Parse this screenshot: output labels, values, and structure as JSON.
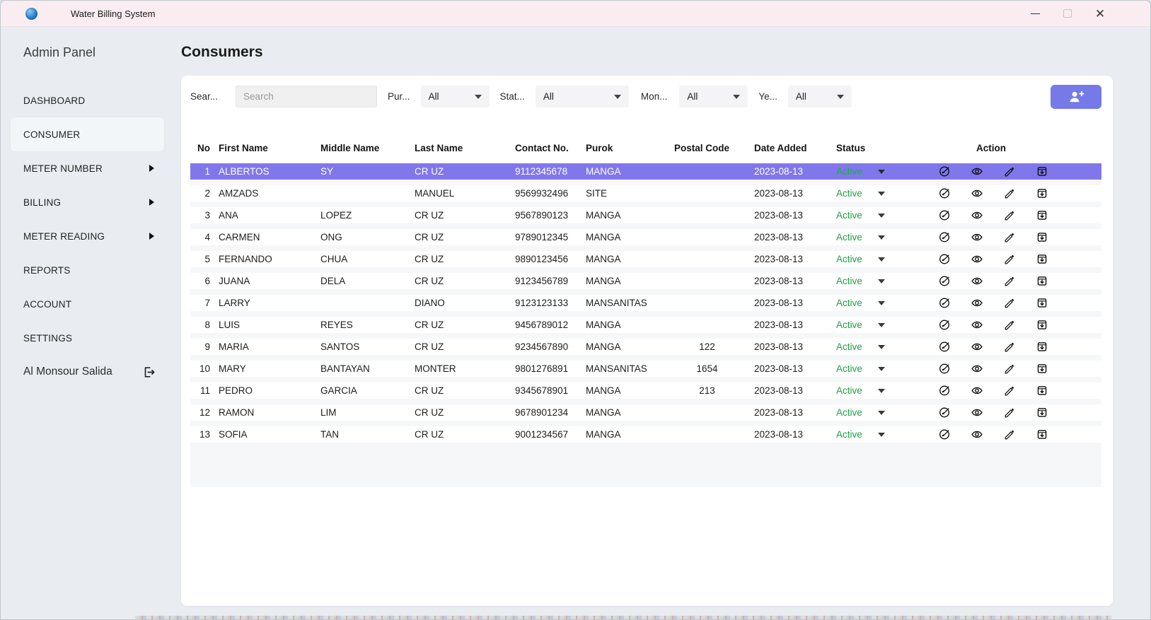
{
  "window": {
    "title": "Water Billing System",
    "app_icon": "water-drop-icon",
    "controls": [
      {
        "name": "minimize",
        "icon": "minimize-icon"
      },
      {
        "name": "maximize",
        "icon": "maximize-icon"
      },
      {
        "name": "close",
        "icon": "close-icon"
      }
    ]
  },
  "sidebar": {
    "brand": "Admin Panel",
    "items": [
      {
        "label": "DASHBOARD",
        "has_submenu": false,
        "active": false
      },
      {
        "label": "CONSUMER",
        "has_submenu": false,
        "active": true
      },
      {
        "label": "METER NUMBER",
        "has_submenu": true,
        "active": false
      },
      {
        "label": "BILLING",
        "has_submenu": true,
        "active": false
      },
      {
        "label": "METER READING",
        "has_submenu": true,
        "active": false
      },
      {
        "label": "REPORTS",
        "has_submenu": false,
        "active": false
      },
      {
        "label": "ACCOUNT",
        "has_submenu": false,
        "active": false
      },
      {
        "label": "SETTINGS",
        "has_submenu": false,
        "active": false
      }
    ],
    "user": {
      "name": "Al Monsour Salida",
      "icon": "logout-icon"
    }
  },
  "main": {
    "title": "Consumers",
    "filters": {
      "search": {
        "label": "Sear...",
        "placeholder": "Search",
        "value": ""
      },
      "purok": {
        "label": "Pur...",
        "value": "All"
      },
      "status": {
        "label": "Stat...",
        "value": "All"
      },
      "month": {
        "label": "Mon...",
        "value": "All"
      },
      "year": {
        "label": "Ye...",
        "value": "All"
      }
    },
    "add_button": {
      "icon": "person-add-icon"
    }
  },
  "table": {
    "columns": [
      "No",
      "First Name",
      "Middle Name",
      "Last Name",
      "Contact No.",
      "Purok",
      "Postal Code",
      "Date Added",
      "Status",
      "Action"
    ],
    "row_actions": [
      "meter",
      "view",
      "edit",
      "archive"
    ],
    "rows": [
      {
        "no": "1",
        "first": "ALBERTOS",
        "middle": "SY",
        "last": "CR UZ",
        "contact": "9112345678",
        "purok": "MANGA",
        "postal": "",
        "date": "2023-08-13",
        "status": "Active",
        "selected": true
      },
      {
        "no": "2",
        "first": "AMZADS",
        "middle": "",
        "last": "MANUEL",
        "contact": "9569932496",
        "purok": "SITE",
        "postal": "",
        "date": "2023-08-13",
        "status": "Active",
        "selected": false
      },
      {
        "no": "3",
        "first": "ANA",
        "middle": "LOPEZ",
        "last": "CR UZ",
        "contact": "9567890123",
        "purok": "MANGA",
        "postal": "",
        "date": "2023-08-13",
        "status": "Active",
        "selected": false
      },
      {
        "no": "4",
        "first": "CARMEN",
        "middle": "ONG",
        "last": "CR UZ",
        "contact": "9789012345",
        "purok": "MANGA",
        "postal": "",
        "date": "2023-08-13",
        "status": "Active",
        "selected": false
      },
      {
        "no": "5",
        "first": "FERNANDO",
        "middle": "CHUA",
        "last": "CR UZ",
        "contact": "9890123456",
        "purok": "MANGA",
        "postal": "",
        "date": "2023-08-13",
        "status": "Active",
        "selected": false
      },
      {
        "no": "6",
        "first": "JUANA",
        "middle": "DELA",
        "last": "CR UZ",
        "contact": "9123456789",
        "purok": "MANGA",
        "postal": "",
        "date": "2023-08-13",
        "status": "Active",
        "selected": false
      },
      {
        "no": "7",
        "first": "LARRY",
        "middle": "",
        "last": "DIANO",
        "contact": "9123123133",
        "purok": "MANSANITAS",
        "postal": "",
        "date": "2023-08-13",
        "status": "Active",
        "selected": false
      },
      {
        "no": "8",
        "first": "LUIS",
        "middle": "REYES",
        "last": "CR UZ",
        "contact": "9456789012",
        "purok": "MANGA",
        "postal": "",
        "date": "2023-08-13",
        "status": "Active",
        "selected": false
      },
      {
        "no": "9",
        "first": "MARIA",
        "middle": "SANTOS",
        "last": "CR UZ",
        "contact": "9234567890",
        "purok": "MANGA",
        "postal": "122",
        "date": "2023-08-13",
        "status": "Active",
        "selected": false
      },
      {
        "no": "10",
        "first": "MARY",
        "middle": "BANTAYAN",
        "last": "MONTER",
        "contact": "9801276891",
        "purok": "MANSANITAS",
        "postal": "1654",
        "date": "2023-08-13",
        "status": "Active",
        "selected": false
      },
      {
        "no": "11",
        "first": "PEDRO",
        "middle": "GARCIA",
        "last": "CR UZ",
        "contact": "9345678901",
        "purok": "MANGA",
        "postal": "213",
        "date": "2023-08-13",
        "status": "Active",
        "selected": false
      },
      {
        "no": "12",
        "first": "RAMON",
        "middle": "LIM",
        "last": "CR UZ",
        "contact": "9678901234",
        "purok": "MANGA",
        "postal": "",
        "date": "2023-08-13",
        "status": "Active",
        "selected": false
      },
      {
        "no": "13",
        "first": "SOFIA",
        "middle": "TAN",
        "last": "CR UZ",
        "contact": "9001234567",
        "purok": "MANGA",
        "postal": "",
        "date": "2023-08-13",
        "status": "Active",
        "selected": false
      }
    ]
  },
  "colors": {
    "accent_purple": "#747ae8",
    "selected_row": "#8177ea",
    "status_active_green": "#1fa044",
    "titlebar_pink": "#f9edf2",
    "app_background": "#e9edf1"
  }
}
